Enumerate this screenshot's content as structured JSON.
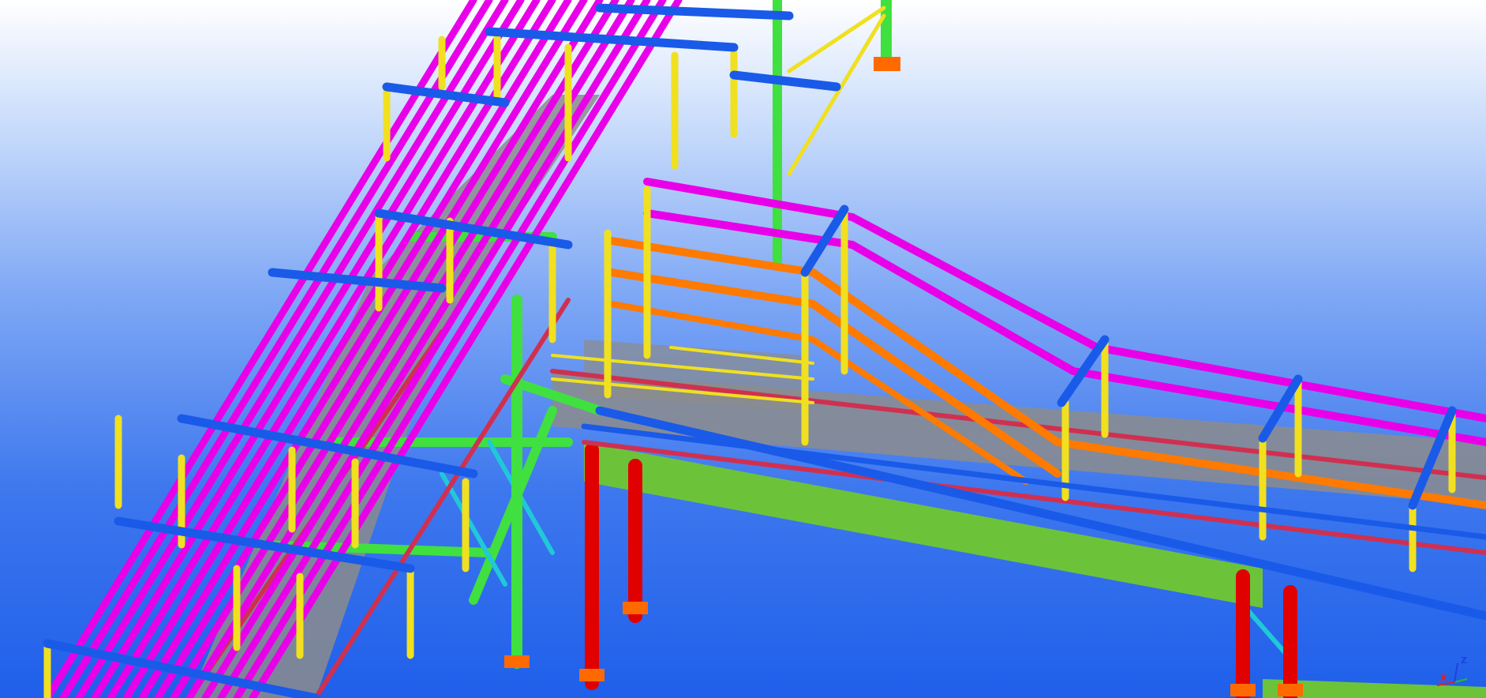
{
  "viewport": {
    "background": {
      "top": "#ffffff",
      "bottom": "#1f5fea"
    },
    "colors": {
      "handrail": "#e800e8",
      "post": "#f0e020",
      "cross_beam": "#1a5ae8",
      "secondary_beam": "#40e040",
      "main_girder": "#6cc33a",
      "column": "#e00000",
      "stair_stringer": "#ff7a00",
      "toe_plate": "#d03050",
      "grating": "#8c8c8c",
      "base_plate": "#ff6a00",
      "brace_cyan": "#20c8d8"
    }
  },
  "axis_gizmo": {
    "x_label": "X",
    "z_label": "Z",
    "x_color": "#e02020",
    "y_color": "#20c020",
    "z_color": "#2040e0"
  }
}
